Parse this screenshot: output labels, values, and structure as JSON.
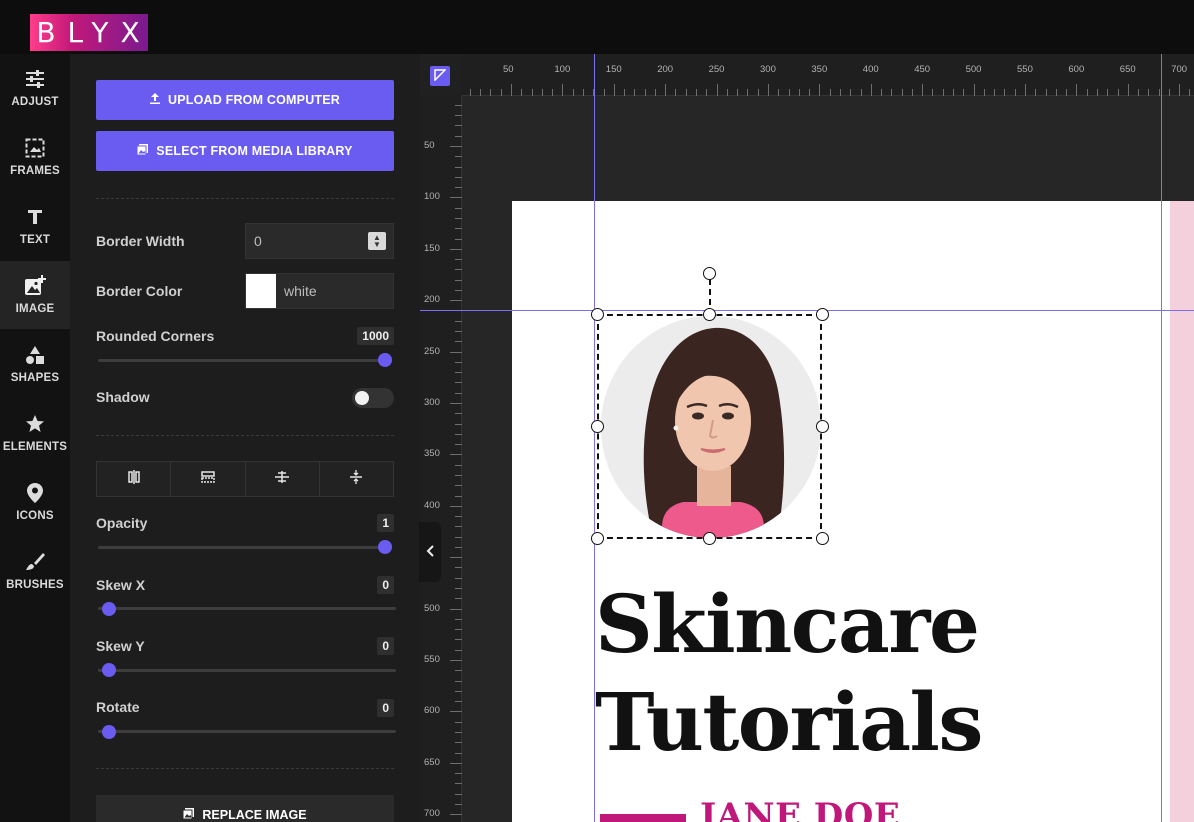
{
  "app": {
    "logo_text": "BLYX",
    "brand_gradient": [
      "#ff3d8b",
      "#7a1a8f"
    ],
    "accent": "#6a5cf0"
  },
  "rail": {
    "items": [
      {
        "label": "ADJUST",
        "icon": "sliders-icon"
      },
      {
        "label": "FRAMES",
        "icon": "frame-icon"
      },
      {
        "label": "TEXT",
        "icon": "text-icon"
      },
      {
        "label": "IMAGE",
        "icon": "image-add-icon",
        "active": true
      },
      {
        "label": "SHAPES",
        "icon": "shapes-icon"
      },
      {
        "label": "ELEMENTS",
        "icon": "star-icon"
      },
      {
        "label": "ICONS",
        "icon": "map-pin-icon"
      },
      {
        "label": "BRUSHES",
        "icon": "brush-icon"
      }
    ]
  },
  "panel": {
    "upload_label": "UPLOAD FROM COMPUTER",
    "media_label": "SELECT FROM MEDIA LIBRARY",
    "border_width": {
      "label": "Border Width",
      "value": "0"
    },
    "border_color": {
      "label": "Border Color",
      "value": "white",
      "swatch": "#ffffff"
    },
    "rounded": {
      "label": "Rounded Corners",
      "value": "1000",
      "fraction": 1.0
    },
    "shadow": {
      "label": "Shadow",
      "on": false
    },
    "align_icons": [
      "align-vertical-center-icon",
      "align-top-icon",
      "align-horizontal-center-icon",
      "distribute-vertical-icon"
    ],
    "opacity": {
      "label": "Opacity",
      "value": "1",
      "fraction": 1.0
    },
    "skew_x": {
      "label": "Skew X",
      "value": "0",
      "fraction": 0.0
    },
    "skew_y": {
      "label": "Skew Y",
      "value": "0",
      "fraction": 0.0
    },
    "rotate": {
      "label": "Rotate",
      "value": "0",
      "fraction": 0.0
    },
    "replace_label": "REPLACE IMAGE"
  },
  "ruler": {
    "h_labels": [
      "50",
      "100",
      "150",
      "200",
      "250",
      "300",
      "350",
      "400",
      "450",
      "500",
      "550",
      "600",
      "650",
      "700"
    ],
    "v_labels": [
      "50",
      "100",
      "150",
      "200",
      "250",
      "300",
      "350",
      "400",
      "450",
      "500",
      "550",
      "600",
      "650",
      "700"
    ]
  },
  "canvas": {
    "heading_line1": "Skincare",
    "heading_line2": "Tutorials",
    "author": "JANE DOE",
    "author_color": "#c0187a"
  }
}
